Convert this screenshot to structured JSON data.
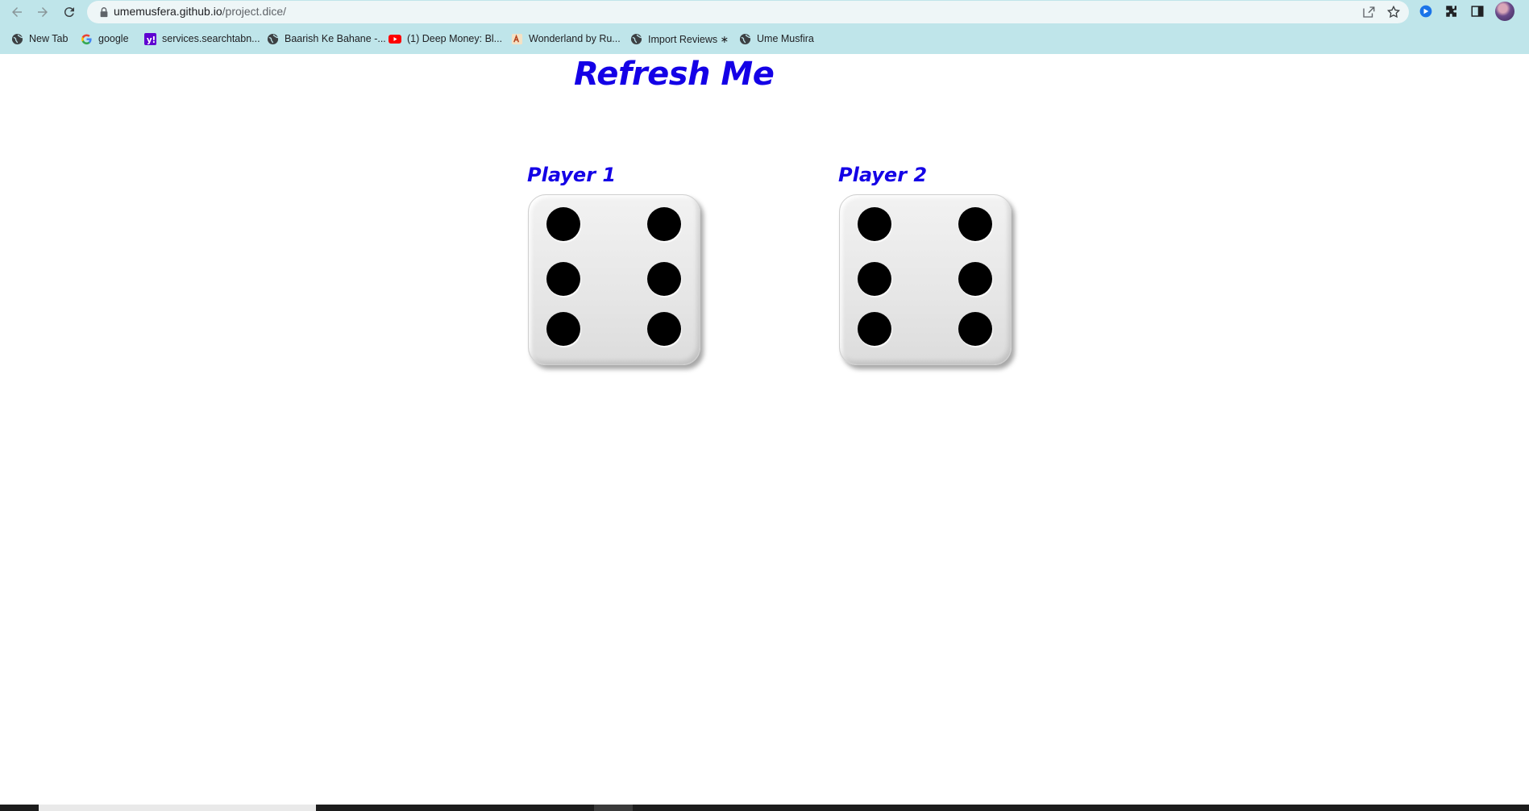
{
  "browser": {
    "url_host": "umemusfera.github.io",
    "url_path": "/project.dice/"
  },
  "bookmarks": [
    {
      "label": "New Tab",
      "icon": "globe-icon"
    },
    {
      "label": "google",
      "icon": "google-icon"
    },
    {
      "label": "services.searchtabn...",
      "icon": "yahoo-icon"
    },
    {
      "label": "Baarish Ke Bahane -...",
      "icon": "globe-icon"
    },
    {
      "label": "(1) Deep Money: Bl...",
      "icon": "youtube-icon"
    },
    {
      "label": "Wonderland by Ru...",
      "icon": "book-icon"
    },
    {
      "label": "Import Reviews ∗",
      "icon": "globe-icon"
    },
    {
      "label": "Ume Musfira",
      "icon": "globe-icon"
    }
  ],
  "page": {
    "title": "Refresh Me",
    "players": [
      {
        "label": "Player 1",
        "die_value": 6
      },
      {
        "label": "Player 2",
        "die_value": 6
      }
    ]
  },
  "colors": {
    "heading": "#1400e6",
    "toolbar": "#bfe5ea"
  }
}
